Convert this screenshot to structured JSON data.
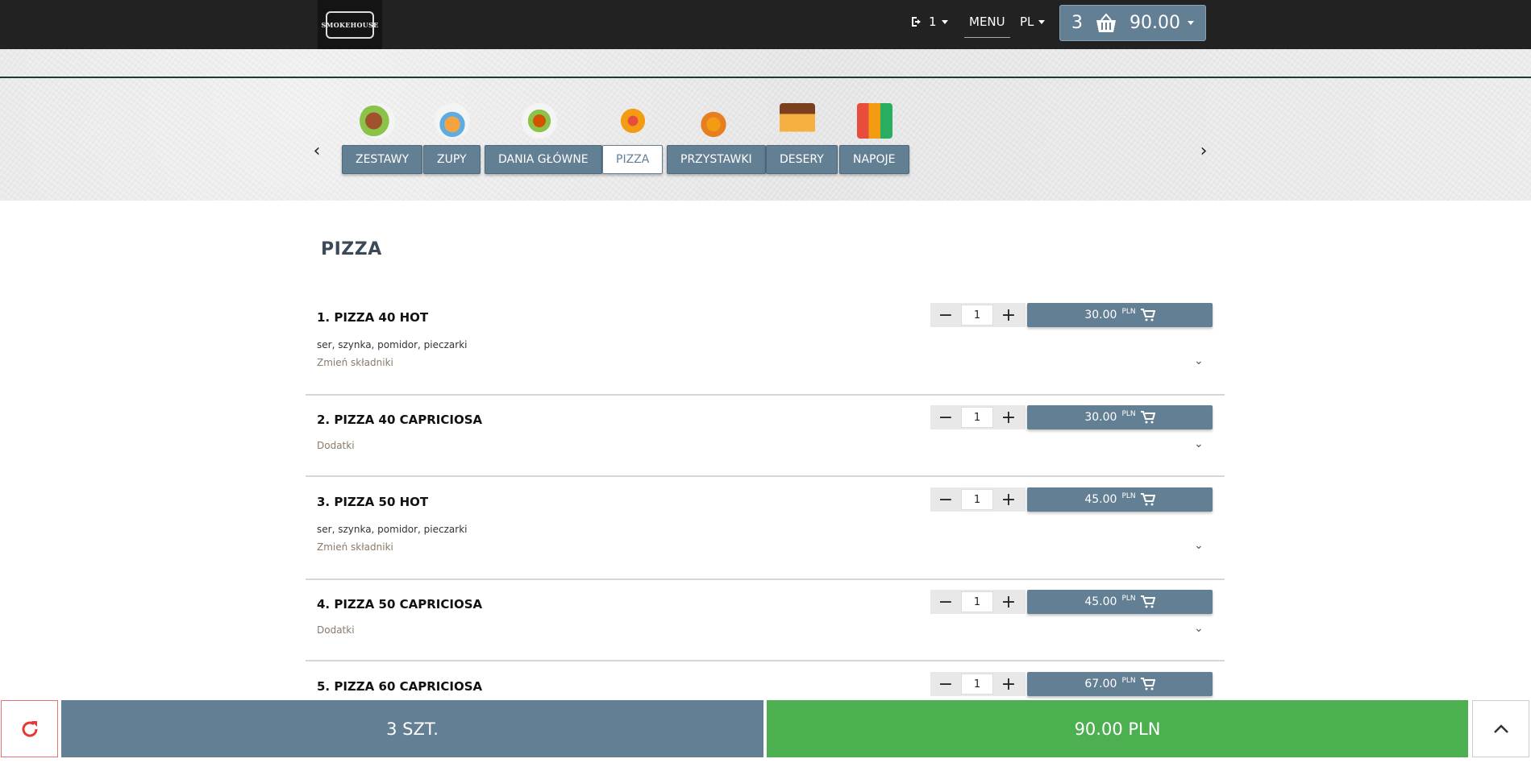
{
  "header": {
    "logo_text": "SMOKEHOUSE",
    "table_number": "1",
    "menu_label": "MENU",
    "language": "PL",
    "cart": {
      "count": "3",
      "total": "90.00"
    }
  },
  "categories": [
    {
      "label": "ZESTAWY",
      "icon": "combo-meal-icon"
    },
    {
      "label": "ZUPY",
      "icon": "soup-bowl-icon"
    },
    {
      "label": "DANIA GŁÓWNE",
      "icon": "main-dish-icon"
    },
    {
      "label": "PIZZA",
      "icon": "pizza-icon",
      "active": true
    },
    {
      "label": "PRZYSTAWKI",
      "icon": "appetizer-icon"
    },
    {
      "label": "DESERY",
      "icon": "cake-icon"
    },
    {
      "label": "NAPOJE",
      "icon": "drinks-icon"
    }
  ],
  "section_title": "PIZZA",
  "items": [
    {
      "name": "1. PIZZA 40 HOT",
      "description": "ser, szynka, pomidor, pieczarki",
      "link": "Zmień składniki",
      "qty": "1",
      "price": "30.00",
      "currency": "PLN"
    },
    {
      "name": "2. PIZZA 40 CAPRICIOSA",
      "description": "",
      "link": "Dodatki",
      "qty": "1",
      "price": "30.00",
      "currency": "PLN"
    },
    {
      "name": "3. PIZZA 50 HOT",
      "description": "ser, szynka, pomidor, pieczarki",
      "link": "Zmień składniki",
      "qty": "1",
      "price": "45.00",
      "currency": "PLN"
    },
    {
      "name": "4. PIZZA 50 CAPRICIOSA",
      "description": "",
      "link": "Dodatki",
      "qty": "1",
      "price": "45.00",
      "currency": "PLN"
    },
    {
      "name": "5. PIZZA 60 CAPRICIOSA",
      "description": "",
      "link": "",
      "qty": "1",
      "price": "67.00",
      "currency": "PLN"
    }
  ],
  "footer": {
    "quantity_label": "3 SZT.",
    "total_label": "90.00 PLN"
  },
  "colors": {
    "accent": "#637f94",
    "topbar": "#222222",
    "total_green": "#4caf50",
    "refresh_red": "#e53935"
  }
}
